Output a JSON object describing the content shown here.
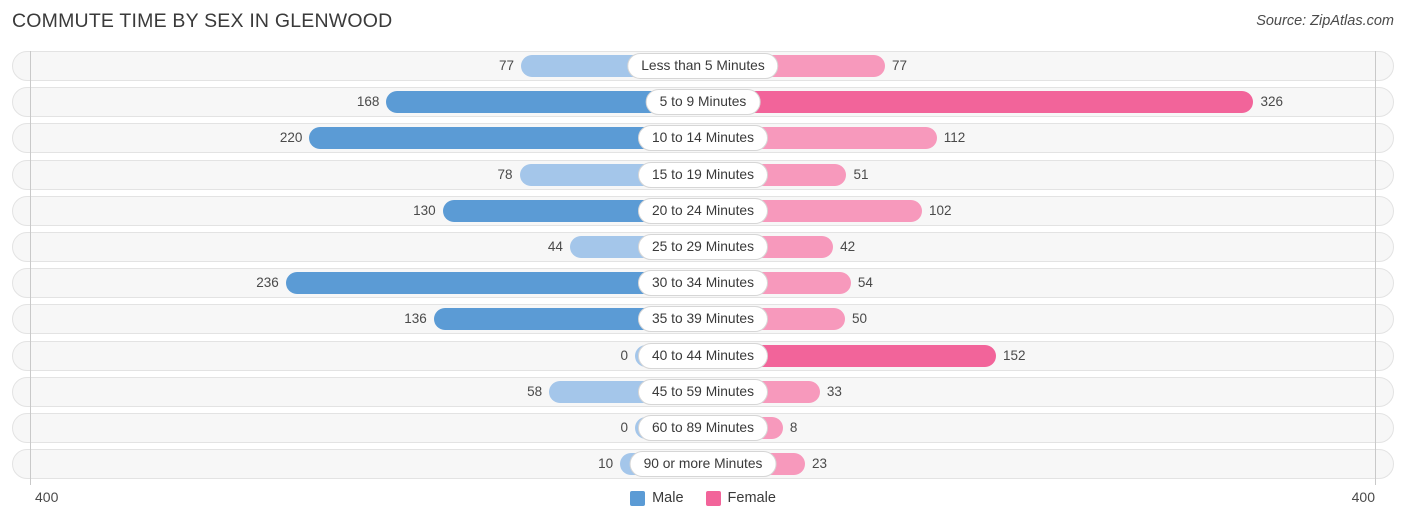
{
  "header": {
    "title": "COMMUTE TIME BY SEX IN GLENWOOD",
    "source": "Source: ZipAtlas.com"
  },
  "legend": {
    "items": [
      {
        "label": "Male",
        "color": "#5b9bd5"
      },
      {
        "label": "Female",
        "color": "#f2649a"
      }
    ]
  },
  "axis": {
    "left_tick": "400",
    "right_tick": "400",
    "max": 400
  },
  "chart_data": {
    "type": "bar",
    "orientation": "horizontal-diverging",
    "title": "COMMUTE TIME BY SEX IN GLENWOOD",
    "xlabel": "",
    "ylabel": "",
    "xlim": [
      400,
      400
    ],
    "grid": false,
    "legend_position": "bottom-center",
    "categories": [
      "Less than 5 Minutes",
      "5 to 9 Minutes",
      "10 to 14 Minutes",
      "15 to 19 Minutes",
      "20 to 24 Minutes",
      "25 to 29 Minutes",
      "30 to 34 Minutes",
      "35 to 39 Minutes",
      "40 to 44 Minutes",
      "45 to 59 Minutes",
      "60 to 89 Minutes",
      "90 or more Minutes"
    ],
    "series": [
      {
        "name": "Male",
        "color": "#5b9bd5",
        "values": [
          77,
          168,
          220,
          78,
          130,
          44,
          236,
          136,
          0,
          58,
          0,
          10
        ]
      },
      {
        "name": "Female",
        "color": "#f2649a",
        "values": [
          77,
          326,
          112,
          51,
          102,
          42,
          54,
          50,
          152,
          33,
          8,
          23
        ]
      }
    ]
  },
  "rows": [
    {
      "label": "Less than 5 Minutes",
      "male": "77",
      "female": "77",
      "male_val": 77,
      "female_val": 77
    },
    {
      "label": "5 to 9 Minutes",
      "male": "168",
      "female": "326",
      "male_val": 168,
      "female_val": 326
    },
    {
      "label": "10 to 14 Minutes",
      "male": "220",
      "female": "112",
      "male_val": 220,
      "female_val": 112
    },
    {
      "label": "15 to 19 Minutes",
      "male": "78",
      "female": "51",
      "male_val": 78,
      "female_val": 51
    },
    {
      "label": "20 to 24 Minutes",
      "male": "130",
      "female": "102",
      "male_val": 130,
      "female_val": 102
    },
    {
      "label": "25 to 29 Minutes",
      "male": "44",
      "female": "42",
      "male_val": 44,
      "female_val": 42
    },
    {
      "label": "30 to 34 Minutes",
      "male": "236",
      "female": "54",
      "male_val": 236,
      "female_val": 54
    },
    {
      "label": "35 to 39 Minutes",
      "male": "136",
      "female": "50",
      "male_val": 136,
      "female_val": 50
    },
    {
      "label": "40 to 44 Minutes",
      "male": "0",
      "female": "152",
      "male_val": 0,
      "female_val": 152
    },
    {
      "label": "45 to 59 Minutes",
      "male": "58",
      "female": "33",
      "male_val": 58,
      "female_val": 33
    },
    {
      "label": "60 to 89 Minutes",
      "male": "0",
      "female": "8",
      "male_val": 0,
      "female_val": 8
    },
    {
      "label": "90 or more Minutes",
      "male": "10",
      "female": "23",
      "male_val": 10,
      "female_val": 23
    }
  ]
}
